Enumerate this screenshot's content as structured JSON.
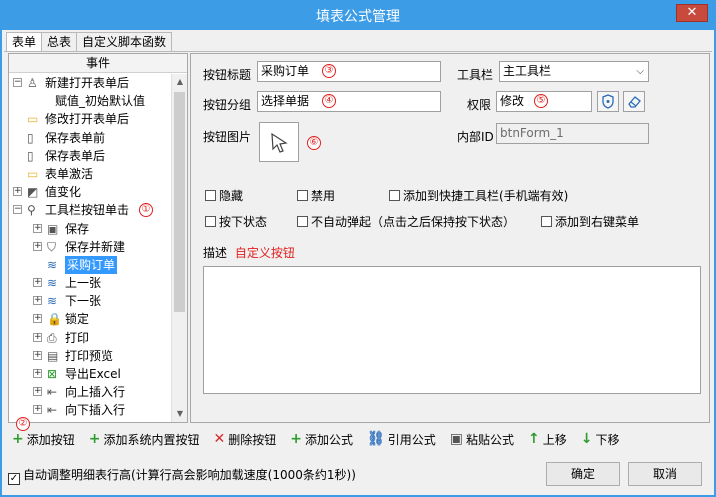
{
  "window": {
    "title": "填表公式管理",
    "close": "✕"
  },
  "tabs": [
    "表单",
    "总表",
    "自定义脚本函数"
  ],
  "tree": {
    "header": "事件",
    "nodes": [
      {
        "label": "新建打开表单后",
        "level": 0,
        "exp": "−",
        "icon": "user-add-icon"
      },
      {
        "label": "赋值_初始默认值",
        "level": 1,
        "exp": "",
        "icon": ""
      },
      {
        "label": "修改打开表单后",
        "level": 0,
        "exp": "",
        "icon": "folder-icon"
      },
      {
        "label": "保存表单前",
        "level": 0,
        "exp": "",
        "icon": "document-icon"
      },
      {
        "label": "保存表单后",
        "level": 0,
        "exp": "",
        "icon": "document-icon"
      },
      {
        "label": "表单激活",
        "level": 0,
        "exp": "",
        "icon": "folder-icon"
      },
      {
        "label": "值变化",
        "level": 0,
        "exp": "+",
        "icon": "value-change-icon"
      },
      {
        "label": "工具栏按钮单击",
        "level": 0,
        "exp": "−",
        "icon": "toolbar-click-icon"
      },
      {
        "label": "保存",
        "level": 1,
        "exp": "+",
        "icon": "save-icon"
      },
      {
        "label": "保存并新建",
        "level": 1,
        "exp": "+",
        "icon": "shield-icon"
      },
      {
        "label": "采购订单",
        "level": 1,
        "exp": "",
        "icon": "layers-icon",
        "selected": true
      },
      {
        "label": "上一张",
        "level": 1,
        "exp": "+",
        "icon": "layers-icon"
      },
      {
        "label": "下一张",
        "level": 1,
        "exp": "+",
        "icon": "layers-icon"
      },
      {
        "label": "锁定",
        "level": 1,
        "exp": "+",
        "icon": "lock-icon"
      },
      {
        "label": "打印",
        "level": 1,
        "exp": "+",
        "icon": "print-icon"
      },
      {
        "label": "打印预览",
        "level": 1,
        "exp": "+",
        "icon": "print-preview-icon"
      },
      {
        "label": "导出Excel",
        "level": 1,
        "exp": "+",
        "icon": "excel-icon"
      },
      {
        "label": "向上插入行",
        "level": 1,
        "exp": "+",
        "icon": "insert-row-icon"
      },
      {
        "label": "向下插入行",
        "level": 1,
        "exp": "+",
        "icon": "insert-row-icon"
      }
    ],
    "marker": "①"
  },
  "form": {
    "btn_title_label": "按钮标题",
    "btn_title_value": "采购订单",
    "btn_title_marker": "③",
    "toolbar_label": "工具栏",
    "toolbar_value": "主工具栏",
    "btn_group_label": "按钮分组",
    "btn_group_value": "选择单据",
    "btn_group_marker": "④",
    "permission_label": "权限",
    "permission_value": "修改",
    "permission_marker": "⑤",
    "btn_image_label": "按钮图片",
    "btn_image_marker": "⑥",
    "internal_id_label": "内部ID",
    "internal_id_value": "btnForm_1",
    "checkboxes": {
      "hidden": "隐藏",
      "disabled": "禁用",
      "add_quick_toolbar": "添加到快捷工具栏(手机端有效)",
      "pressed_state": "按下状态",
      "no_auto_popup": "不自动弹起（点击之后保持按下状态）",
      "add_context_menu": "添加到右键菜单"
    },
    "desc_label": "描述",
    "desc_value": "自定义按钮"
  },
  "toolbar": {
    "marker": "②",
    "add_button": "添加按钮",
    "add_system_button": "添加系统内置按钮",
    "delete_button": "删除按钮",
    "add_formula": "添加公式",
    "ref_formula": "引用公式",
    "paste_formula": "粘贴公式",
    "move_up": "上移",
    "move_down": "下移"
  },
  "bottom": {
    "auto_adjust_label": "自动调整明细表行高(计算行高会影响加载速度(1000条约1秒))",
    "ok": "确定",
    "cancel": "取消"
  },
  "colors": {
    "title_bar": "#3c9ce6",
    "selected": "#3399ff",
    "marker": "#e02020",
    "desc": "#e02020"
  }
}
